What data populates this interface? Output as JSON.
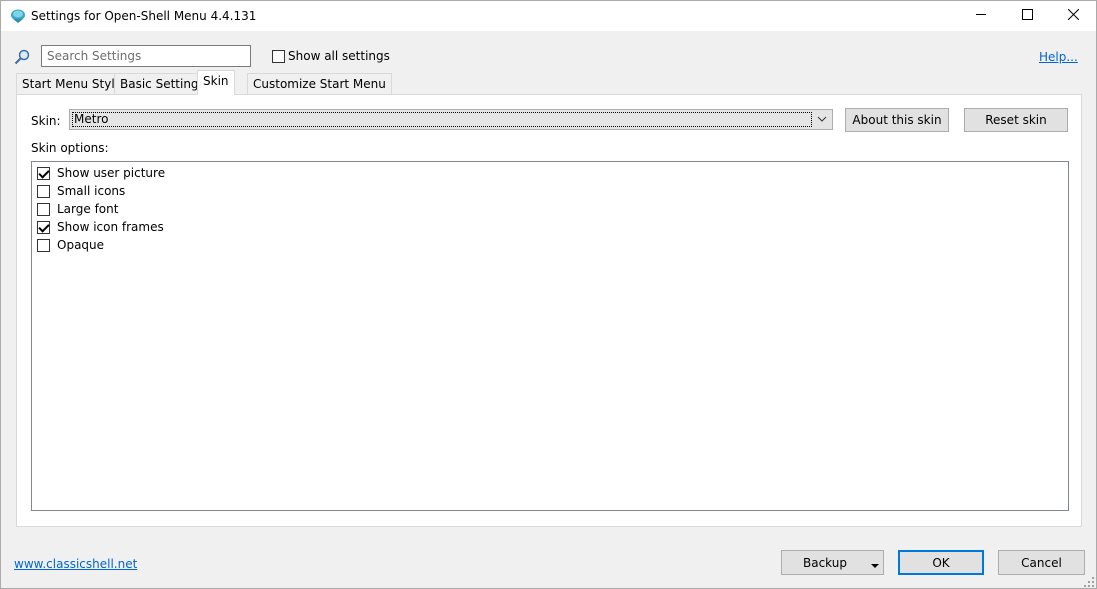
{
  "window": {
    "title": "Settings for Open-Shell Menu 4.4.131"
  },
  "toolbar": {
    "search_placeholder": "Search Settings",
    "show_all_label": "Show all settings",
    "show_all_checked": false,
    "help_label": "Help..."
  },
  "tabs": [
    {
      "label": "Start Menu Style",
      "active": false
    },
    {
      "label": "Basic Settings",
      "active": false
    },
    {
      "label": "Skin",
      "active": true
    },
    {
      "label": "Customize Start Menu",
      "active": false
    }
  ],
  "skin": {
    "label": "Skin:",
    "selected": "Metro",
    "about_button": "About this skin",
    "reset_button": "Reset skin",
    "options_label": "Skin options:",
    "options": [
      {
        "label": "Show user picture",
        "checked": true
      },
      {
        "label": "Small icons",
        "checked": false
      },
      {
        "label": "Large font",
        "checked": false
      },
      {
        "label": "Show icon frames",
        "checked": true
      },
      {
        "label": "Opaque",
        "checked": false
      }
    ]
  },
  "footer": {
    "link": "www.classicshell.net",
    "backup_button": "Backup",
    "ok_button": "OK",
    "cancel_button": "Cancel"
  },
  "colors": {
    "link": "#0066cc",
    "focus_border": "#0078d7",
    "window_bg": "#f0f0f0"
  },
  "icons": {
    "app": "shell-icon",
    "search": "search-icon",
    "minimize": "minimize-icon",
    "maximize": "maximize-icon",
    "close": "close-icon",
    "dropdown": "chevron-down-icon",
    "resize": "resize-grip-icon"
  }
}
